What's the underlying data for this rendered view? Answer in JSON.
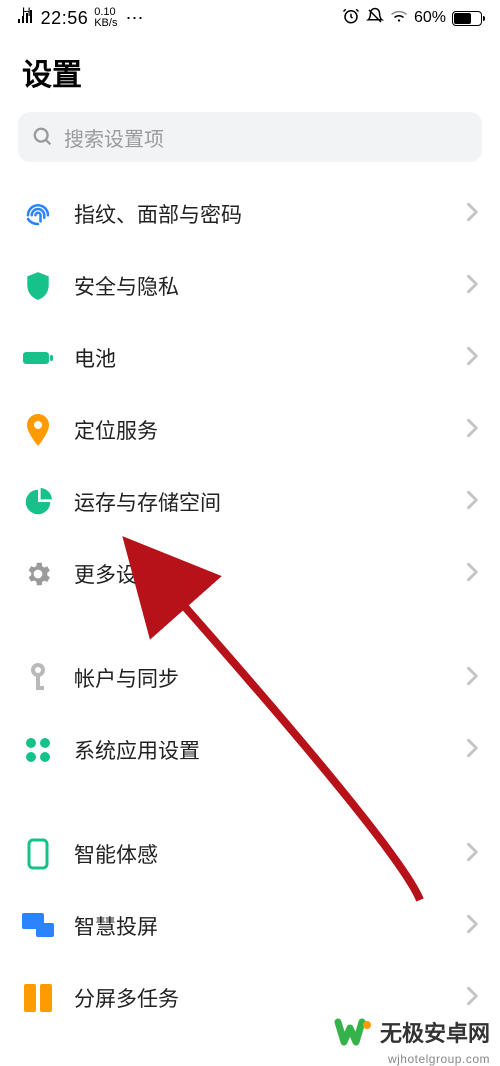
{
  "status": {
    "signal_prefix": "H",
    "time": "22:56",
    "speed_top": "0.10",
    "speed_bottom": "KB/s",
    "battery_pct": "60%"
  },
  "header": {
    "title": "设置"
  },
  "search": {
    "placeholder": "搜索设置项"
  },
  "groups": {
    "g1": [
      {
        "id": "fingerprint",
        "label": "指纹、面部与密码",
        "icon": "fingerprint-icon"
      },
      {
        "id": "security",
        "label": "安全与隐私",
        "icon": "shield-icon"
      },
      {
        "id": "battery",
        "label": "电池",
        "icon": "battery-icon"
      },
      {
        "id": "location",
        "label": "定位服务",
        "icon": "location-pin-icon"
      },
      {
        "id": "storage",
        "label": "运存与存储空间",
        "icon": "pie-chart-icon"
      },
      {
        "id": "more",
        "label": "更多设置",
        "icon": "gear-icon"
      }
    ],
    "g2": [
      {
        "id": "accounts",
        "label": "帐户与同步",
        "icon": "key-icon"
      },
      {
        "id": "sysapps",
        "label": "系统应用设置",
        "icon": "apps-grid-icon"
      }
    ],
    "g3": [
      {
        "id": "smartmotion",
        "label": "智能体感",
        "icon": "phone-outline-icon"
      },
      {
        "id": "smartcast",
        "label": "智慧投屏",
        "icon": "cast-devices-icon"
      },
      {
        "id": "splitscreen",
        "label": "分屏多任务",
        "icon": "split-screen-icon"
      }
    ]
  },
  "watermark": {
    "main": "无极安卓网",
    "sub": "wjhotelgroup.com"
  },
  "colors": {
    "accent_green": "#17c28a",
    "accent_orange": "#ff9a00",
    "accent_blue": "#2b83ff",
    "grey_icon": "#b9b9b9",
    "arrow_red": "#b7121a"
  }
}
